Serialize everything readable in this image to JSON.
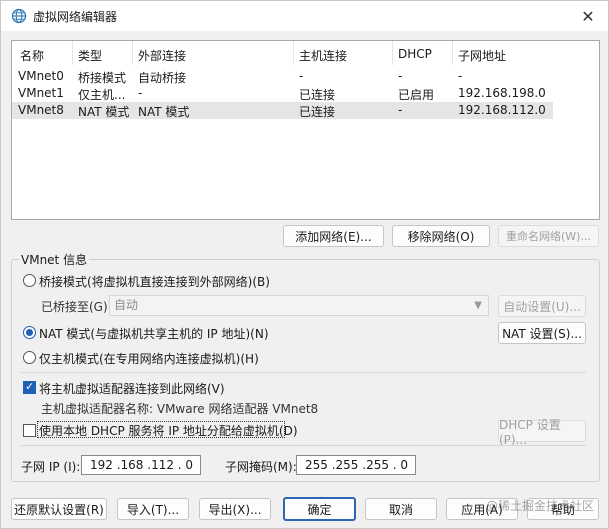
{
  "window": {
    "title": "虚拟网络编辑器",
    "close_glyph": "✕"
  },
  "table": {
    "headers": [
      "名称",
      "类型",
      "外部连接",
      "主机连接",
      "DHCP",
      "子网地址"
    ],
    "rows": [
      [
        "VMnet0",
        "桥接模式",
        "自动桥接",
        "-",
        "-",
        "-"
      ],
      [
        "VMnet1",
        "仅主机...",
        "-",
        "已连接",
        "已启用",
        "192.168.198.0"
      ],
      [
        "VMnet8",
        "NAT 模式",
        "NAT 模式",
        "已连接",
        "-",
        "192.168.112.0"
      ]
    ],
    "selected_row": 2
  },
  "table_buttons": {
    "add": "添加网络(E)...",
    "remove": "移除网络(O)",
    "rename": "重命名网络(W)..."
  },
  "vmnet_info": {
    "group_label": "VMnet 信息",
    "bridged_label": "桥接模式(将虚拟机直接连接到外部网络)(B)",
    "bridged_to_label": "已桥接至(G):",
    "bridged_to_value": "自动",
    "auto_settings": "自动设置(U)...",
    "nat_label": "NAT 模式(与虚拟机共享主机的 IP 地址)(N)",
    "nat_settings": "NAT 设置(S)...",
    "hostonly_label": "仅主机模式(在专用网络内连接虚拟机)(H)",
    "selected_mode": "nat",
    "connect_adapter_label": "将主机虚拟适配器连接到此网络(V)",
    "connect_adapter_checked": true,
    "adapter_name_label": "主机虚拟适配器名称: VMware 网络适配器 VMnet8",
    "dhcp_label": "使用本地 DHCP 服务将 IP 地址分配给虚拟机(D)",
    "dhcp_checked": false,
    "dhcp_settings": "DHCP 设置(P)...",
    "subnet_ip_label": "子网 IP (I):",
    "subnet_ip_value": "192 .168 .112 . 0",
    "subnet_mask_label": "子网掩码(M):",
    "subnet_mask_value": "255 .255 .255 . 0"
  },
  "footer": {
    "restore": "还原默认设置(R)",
    "import": "导入(T)...",
    "export": "导出(X)...",
    "ok": "确定",
    "cancel": "取消",
    "apply": "应用(A)",
    "help": "帮助"
  },
  "watermark": "@稀土掘金技术社区",
  "colors": {
    "accent": "#1f5fb4",
    "selected_row": "#e5e5e5",
    "background": "#f0f0f0"
  }
}
